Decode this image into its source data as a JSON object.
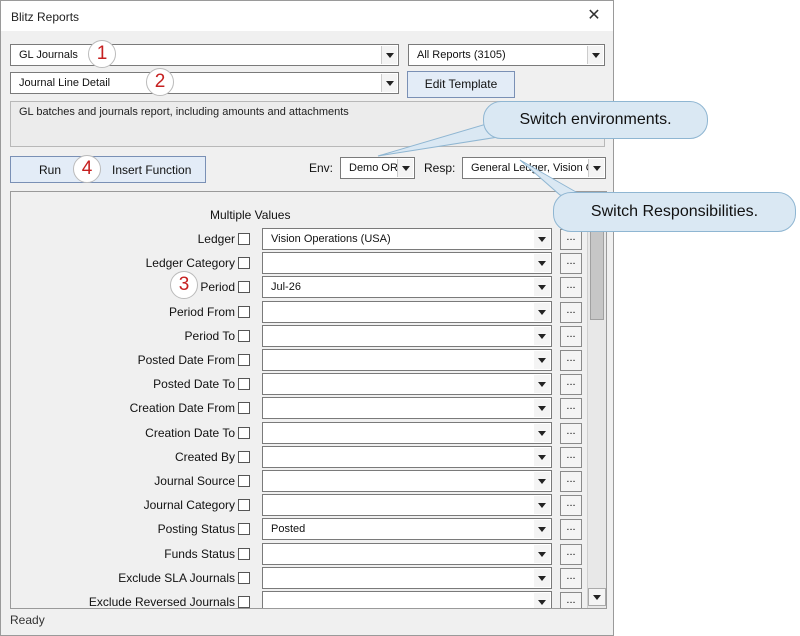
{
  "window": {
    "title": "Blitz Reports"
  },
  "report_combo": {
    "value": "GL Journals"
  },
  "all_reports_combo": {
    "value": "All Reports (3105)"
  },
  "template_combo": {
    "value": "Journal Line Detail"
  },
  "edit_template_button": {
    "label": "Edit Template"
  },
  "description": "GL batches and journals report, including amounts and attachments",
  "run_button": {
    "label": "Run"
  },
  "insert_function_button": {
    "label": "Insert Function"
  },
  "env": {
    "label": "Env:",
    "value": "Demo OR"
  },
  "resp": {
    "label": "Resp:",
    "value": "General Ledger, Vision Op"
  },
  "parameters": {
    "header": "Multiple Values",
    "rows": [
      {
        "label": "Ledger",
        "value": "Vision Operations (USA)"
      },
      {
        "label": "Ledger Category",
        "value": ""
      },
      {
        "label": "Period",
        "value": "Jul-26"
      },
      {
        "label": "Period From",
        "value": ""
      },
      {
        "label": "Period To",
        "value": ""
      },
      {
        "label": "Posted Date From",
        "value": ""
      },
      {
        "label": "Posted Date To",
        "value": ""
      },
      {
        "label": "Creation Date From",
        "value": ""
      },
      {
        "label": "Creation Date To",
        "value": ""
      },
      {
        "label": "Created By",
        "value": ""
      },
      {
        "label": "Journal Source",
        "value": ""
      },
      {
        "label": "Journal Category",
        "value": ""
      },
      {
        "label": "Posting Status",
        "value": "Posted"
      },
      {
        "label": "Funds Status",
        "value": ""
      },
      {
        "label": "Exclude SLA Journals",
        "value": ""
      },
      {
        "label": "Exclude Reversed Journals",
        "value": ""
      }
    ],
    "ellipsis": "..."
  },
  "status": "Ready",
  "annotations": {
    "badges": [
      "1",
      "2",
      "3",
      "4"
    ],
    "callout_env": "Switch environments.",
    "callout_resp": "Switch Responsibilities."
  }
}
